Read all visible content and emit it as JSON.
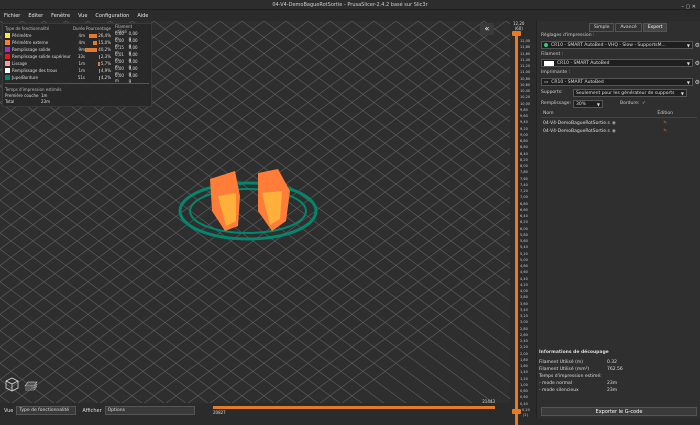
{
  "window": {
    "title": "04-V4-DemoBagueRotSortie - PrusaSlicer-2.4.2 basé sur Slic3r",
    "controls": "–  ▢  ✕"
  },
  "menu": [
    "Fichier",
    "Editer",
    "Fenêtre",
    "Vue",
    "Configuration",
    "Aide"
  ],
  "legend": {
    "headers": [
      "Type de fonctionnalité",
      "Durée",
      "Pourcentage",
      "Filament utilisé"
    ],
    "rows": [
      {
        "name": "Périmètre",
        "time": "4m",
        "pct": "26,4%",
        "pct_value": 26.4,
        "len": "0,60 m",
        "wt": "0,00 g",
        "color": "#FFE629"
      },
      {
        "name": "Périmètre externe",
        "time": "4m",
        "pct": "15,0%",
        "pct_value": 15.0,
        "len": "0,00 m",
        "wt": "0,00 g",
        "color": "#FF7D38"
      },
      {
        "name": "Remplissage solide",
        "time": "9m",
        "pct": "40,2%",
        "pct_value": 40.2,
        "len": "0,15 m",
        "wt": "0,00 g",
        "color": "#9933C8"
      },
      {
        "name": "Remplissage solide supérieur",
        "time": "33s",
        "pct": "2,3%",
        "pct_value": 2.3,
        "len": "0,01 m",
        "wt": "0,00 g",
        "color": "#E61919"
      },
      {
        "name": "Lissage",
        "time": "1m",
        "pct": "5,7%",
        "pct_value": 5.7,
        "len": "0,00 m",
        "wt": "0,00 g",
        "color": "#F0A0A0"
      },
      {
        "name": "Remplissage des trous",
        "time": "1m",
        "pct": "4,9%",
        "pct_value": 4.9,
        "len": "0,00 m",
        "wt": "0,00 g",
        "color": "#FFFFFF"
      },
      {
        "name": "Jupe/Bordure",
        "time": "51s",
        "pct": "4,2%",
        "pct_value": 4.2,
        "len": "0,00 m",
        "wt": "0,00 g",
        "color": "#00876E"
      }
    ],
    "time_title": "Temps d'impression estimés",
    "time_rows": [
      {
        "label": "Première couche",
        "value": "1m"
      },
      {
        "label": "Total",
        "value": "23m"
      }
    ]
  },
  "vslider": {
    "top_value": "12,20",
    "top_layer": "(60)",
    "bottom_value": "0,20",
    "bottom_layer": "(1)",
    "ticks": [
      "12,00",
      "11,80",
      "11,60",
      "11,40",
      "11,20",
      "11,00",
      "10,80",
      "10,60",
      "10,40",
      "10,20",
      "10,00",
      "9,80",
      "9,60",
      "9,40",
      "9,20",
      "9,00",
      "8,80",
      "8,60",
      "8,40",
      "8,20",
      "8,00",
      "7,80",
      "7,60",
      "7,40",
      "7,20",
      "7,00",
      "6,80",
      "6,60",
      "6,40",
      "6,20",
      "6,00",
      "5,80",
      "5,60",
      "5,40",
      "5,20",
      "5,00",
      "4,80",
      "4,60",
      "4,40",
      "4,20",
      "4,00",
      "3,80",
      "3,60",
      "3,40",
      "3,20",
      "3,00",
      "2,80",
      "2,60",
      "2,40",
      "2,20",
      "2,00",
      "1,80",
      "1,60",
      "1,40",
      "1,20",
      "1,00",
      "0,80",
      "0,60",
      "0,40"
    ]
  },
  "bottom": {
    "view_label": "Vue",
    "view_value": "Type de fonctionnalité",
    "show_label": "Afficher",
    "show_value": "Options",
    "h_left": "20827",
    "h_right": "21443"
  },
  "right": {
    "modes": [
      "Simple",
      "Avancé",
      "Expert"
    ],
    "print_label": "Réglages d'impression :",
    "print_value": "CR10 - SMART AutoBed - VHQ - Slow - SupportsM...",
    "filament_label": "Filament :",
    "filament_value": "CR10 - SMART AutoBed",
    "printer_label": "Imprimante :",
    "printer_value": "CR10 - SMART AutoBed",
    "supports_label": "Supports:",
    "supports_value": "Seulement pour les générateur de supports",
    "infill_label": "Remplissage:",
    "infill_value": "30%",
    "brim_label": "Bordure:",
    "brim_check": "✓",
    "obj_header_name": "Nom",
    "obj_header_edit": "Édition",
    "objects": [
      "04-V4-DemoBagueRotSortie.s",
      "04-V4-DemoBagueRotSortie.s"
    ],
    "info_title": "Informations de découpage",
    "info_rows": [
      {
        "label": "Filament Utilisé (m)",
        "value": "0.32"
      },
      {
        "label": "Filament Utilisé (mm³)",
        "value": "762.56"
      },
      {
        "label": "Temps d'impression estimé:",
        "value": ""
      },
      {
        "label": "  - mode normal",
        "value": "23m"
      },
      {
        "label": "  - mode silencieux",
        "value": "23m"
      }
    ],
    "export_label": "Exporter le G-code"
  }
}
